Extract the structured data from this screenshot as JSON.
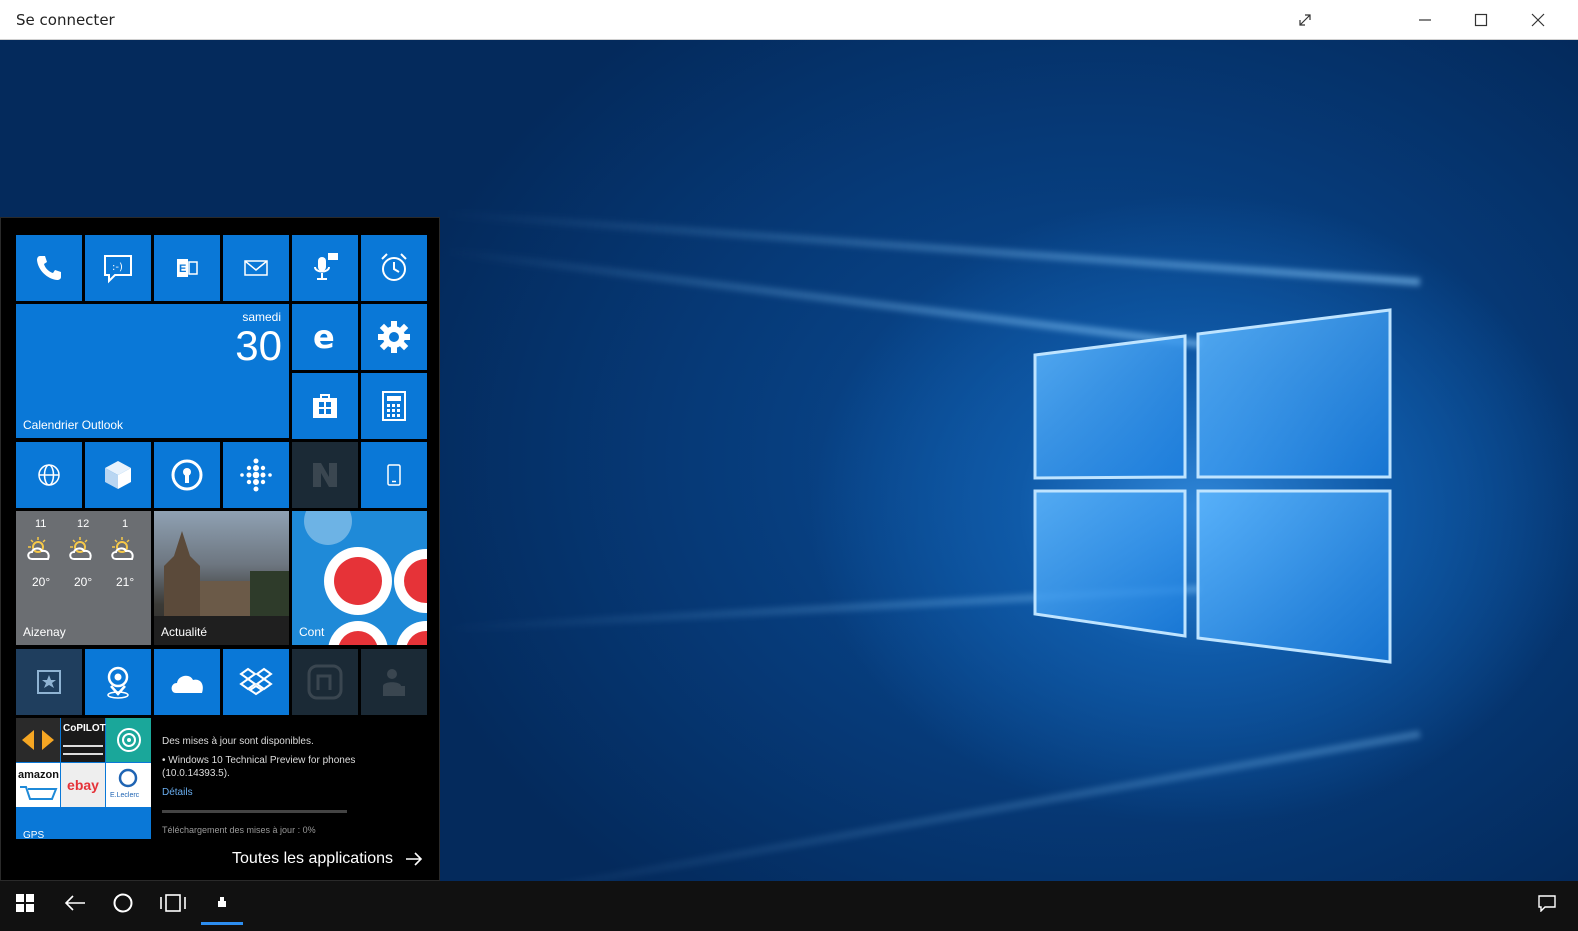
{
  "window": {
    "title": "Se connecter",
    "controls": {
      "expand": "expand-icon",
      "minimize": "minimize-icon",
      "maximize": "maximize-icon",
      "close": "close-icon"
    }
  },
  "start": {
    "calendar": {
      "day_name": "samedi",
      "day_number": "30",
      "label": "Calendrier Outlook"
    },
    "weather": {
      "hours": [
        "11",
        "12",
        "1"
      ],
      "temps": [
        "20°",
        "20°",
        "21°"
      ],
      "location": "Aizenay"
    },
    "news_label": "Actualité",
    "contacts_label": "Cont",
    "gps_label": "GPS",
    "folder_brands": [
      "CoPILOT",
      "amazon",
      "ebay",
      "E.Leclerc"
    ],
    "update": {
      "line1": "Des mises à jour sont disponibles.",
      "line2": "• Windows 10 Technical Preview for phones (10.0.14393.5).",
      "details": "Détails",
      "progress": "Téléchargement des mises à jour : 0%"
    },
    "all_apps": "Toutes les applications"
  },
  "colors": {
    "tile": "#0a78d7",
    "start_bg": "#000000",
    "taskbar": "#111111",
    "active": "#2d8ef0"
  }
}
